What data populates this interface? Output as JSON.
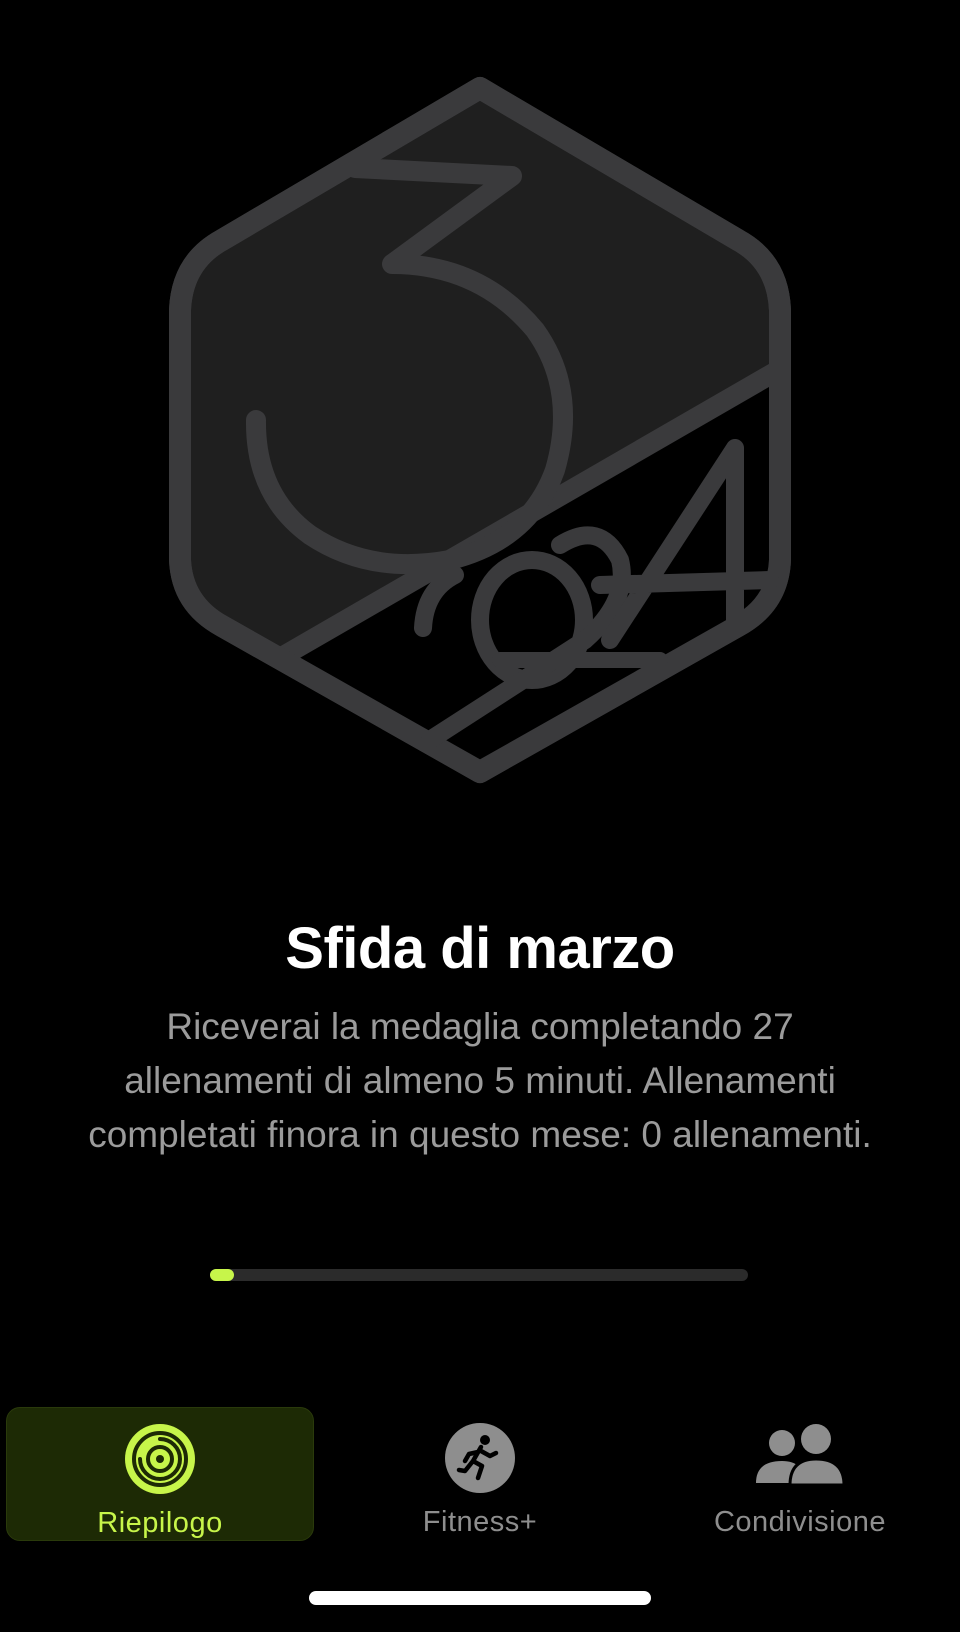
{
  "challenge": {
    "title": "Sfida di marzo",
    "description": "Riceverai la medaglia completando 27 allenamenti di almeno 5 minuti. Allenamenti completati finora in questo mese: 0 allenamenti.",
    "progress_fraction": 0.0
  },
  "badge": {
    "icon": "march-2024-challenge-badge-icon"
  },
  "tabs": [
    {
      "label": "Riepilogo",
      "icon": "activity-rings-icon",
      "active": true
    },
    {
      "label": "Fitness+",
      "icon": "running-figure-icon",
      "active": false
    },
    {
      "label": "Condivisione",
      "icon": "people-icon",
      "active": false
    }
  ],
  "colors": {
    "accent": "#c7f54a",
    "badge_stroke": "#3a3a3c",
    "badge_fill": "#1f1f1f",
    "tab_inactive": "#8e8e8e"
  }
}
